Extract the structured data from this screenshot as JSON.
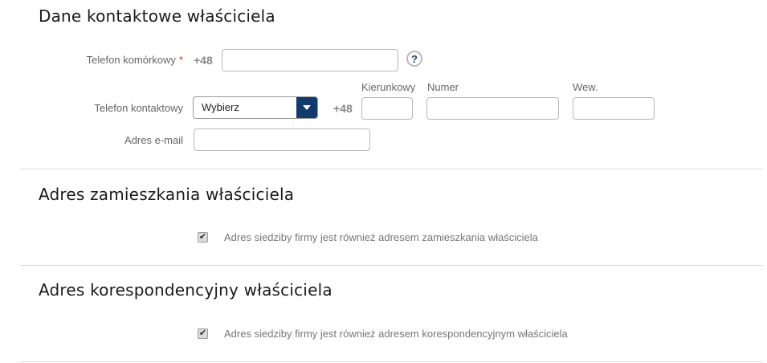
{
  "contact": {
    "title": "Dane kontaktowe właściciela",
    "mobile_label": "Telefon komórkowy",
    "required_mark": "*",
    "mobile_prefix": "+48",
    "mobile_value": "",
    "help_glyph": "?",
    "phone_label": "Telefon kontaktowy",
    "phone_type_selected": "Wybierz",
    "phone_prefix": "+48",
    "area_code_label": "Kierunkowy",
    "number_label": "Numer",
    "extension_label": "Wew.",
    "area_code_value": "",
    "number_value": "",
    "extension_value": "",
    "email_label": "Adres e-mail",
    "email_value": ""
  },
  "residence": {
    "title": "Adres zamieszkania właściciela",
    "same_checkbox_label": "Adres siedziby firmy jest również adresem zamieszkania właściciela",
    "same_checked": true
  },
  "correspondence": {
    "title": "Adres korespondencyjny właściciela",
    "same_checkbox_label": "Adres siedziby firmy jest również adresem korespondencyjnym właściciela",
    "same_checked": true
  },
  "icons": {
    "check_glyph": "✔",
    "select_arrow": "caret-down-icon",
    "help_icon": "question-mark-icon"
  },
  "colors": {
    "required": "#d9303b",
    "select_button": "#123a6c",
    "help_text": "#1d3b6b"
  }
}
